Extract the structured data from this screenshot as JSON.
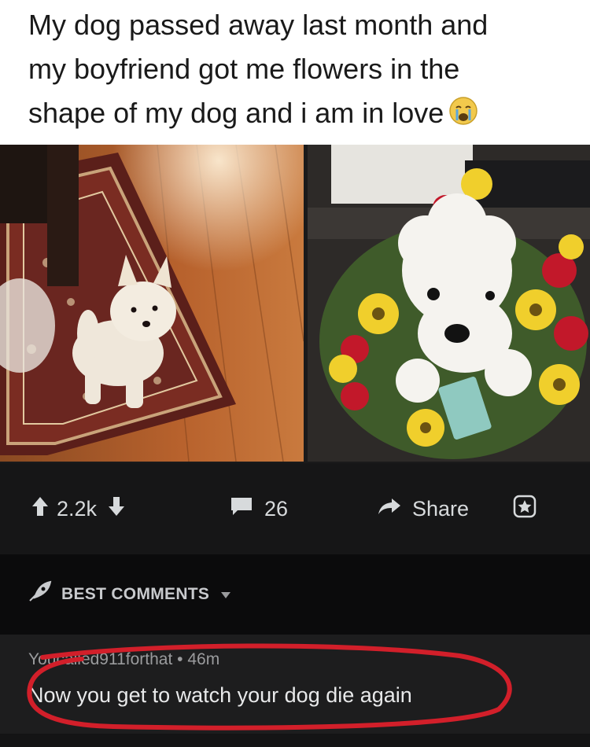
{
  "caption": {
    "line1": "My dog passed away last month and",
    "line2": "my boyfriend got me flowers in the",
    "line3": "shape of my dog and i am in love",
    "emoji": "crying-face-emoji"
  },
  "actions": {
    "upvotes": "2.2k",
    "comments": "26",
    "share_label": "Share"
  },
  "sort": {
    "label": "BEST COMMENTS"
  },
  "comment": {
    "username": "Youcalled911forthat",
    "separator": "•",
    "age": "46m",
    "body": "Now you get to watch your dog die again"
  },
  "colors": {
    "accent_red_annotation": "#d21f2a",
    "dark_bg": "#161617",
    "text_light": "#d7dadc"
  }
}
